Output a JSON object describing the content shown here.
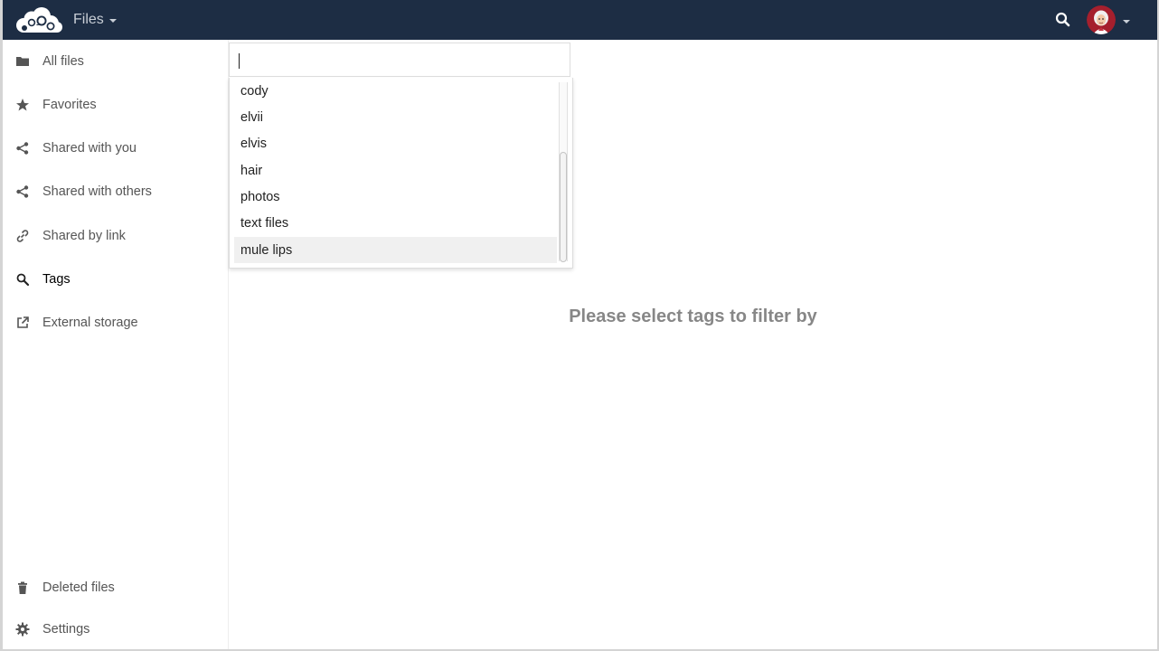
{
  "header": {
    "app_name": "Files",
    "colors": {
      "background": "#1d2d44",
      "text": "#c8ced6"
    },
    "icons": {
      "logo": "owncloud-logo",
      "search": "search-icon",
      "avatar": "user-avatar"
    }
  },
  "sidebar": {
    "items": [
      {
        "label": "All files",
        "icon": "folder-icon",
        "active": false
      },
      {
        "label": "Favorites",
        "icon": "star-icon",
        "active": false
      },
      {
        "label": "Shared with you",
        "icon": "share-icon",
        "active": false
      },
      {
        "label": "Shared with others",
        "icon": "share-icon",
        "active": false
      },
      {
        "label": "Shared by link",
        "icon": "link-icon",
        "active": false
      },
      {
        "label": "Tags",
        "icon": "search-icon",
        "active": true
      },
      {
        "label": "External storage",
        "icon": "external-link-icon",
        "active": false
      }
    ],
    "bottom_items": [
      {
        "label": "Deleted files",
        "icon": "trash-icon"
      },
      {
        "label": "Settings",
        "icon": "gear-icon"
      }
    ]
  },
  "tag_filter": {
    "input_value": "",
    "dropdown_options": [
      "cody",
      "elvii",
      "elvis",
      "hair",
      "photos",
      "text files",
      "mule lips"
    ],
    "highlighted_option": "mule lips"
  },
  "main": {
    "empty_message": "Please select tags to filter by"
  }
}
